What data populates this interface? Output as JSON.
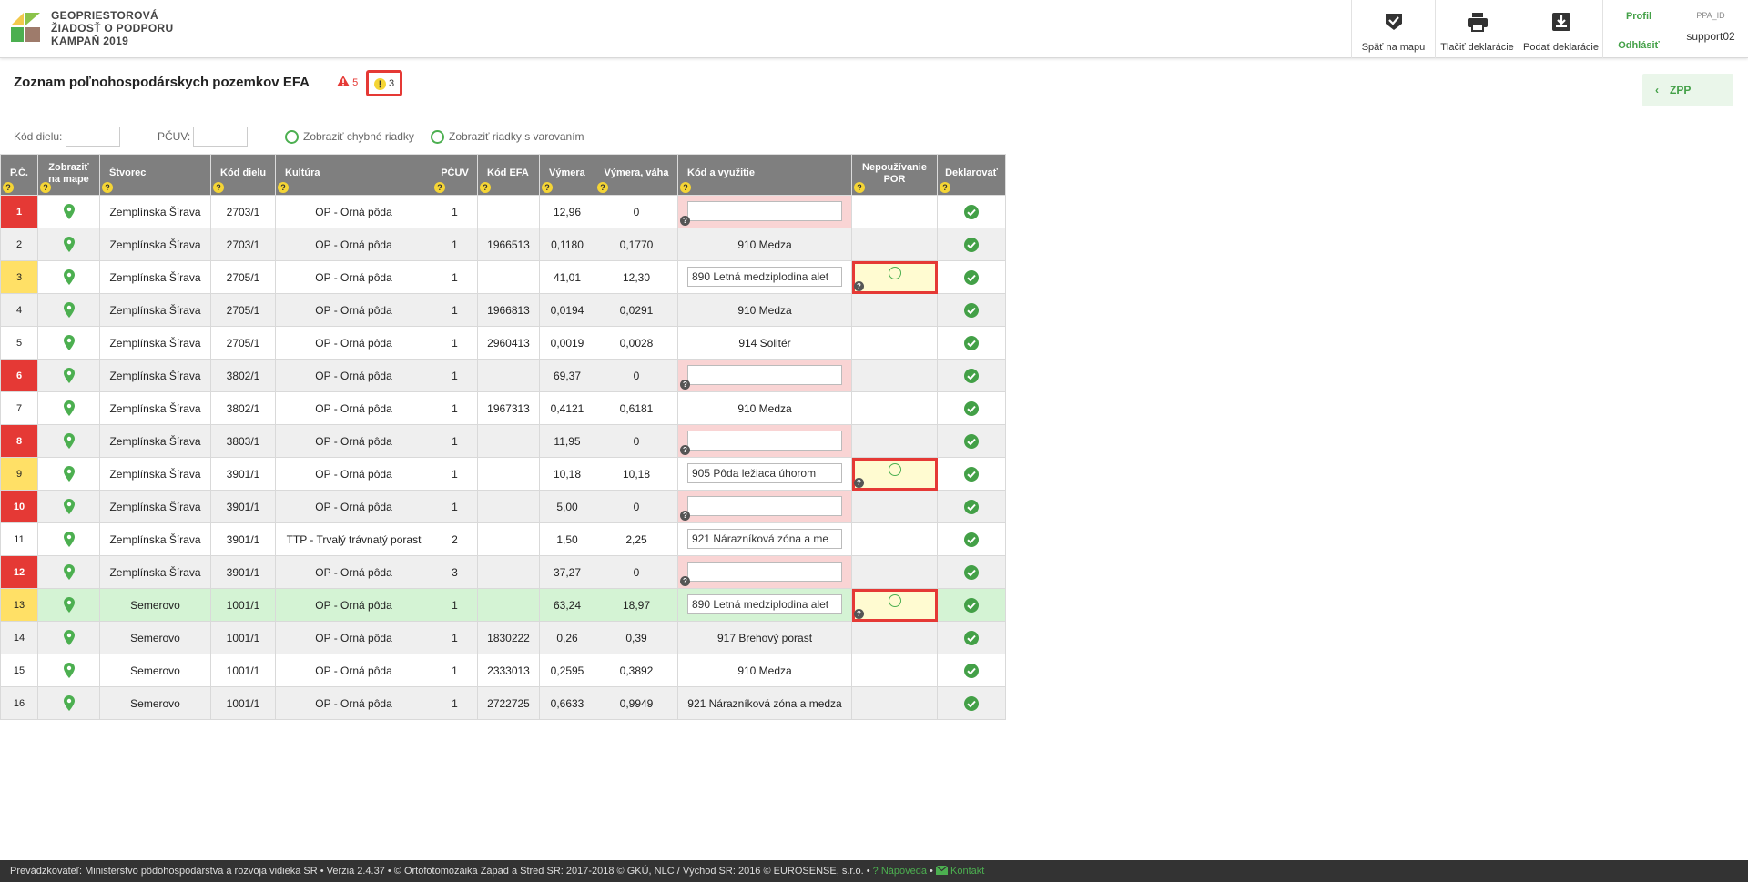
{
  "header": {
    "title_line1": "GEOPRIESTOROVÁ",
    "title_line2": "ŽIADOSŤ O PODPORU",
    "title_line3": "KAMPAŇ 2019",
    "buttons": [
      {
        "label": "Späť na mapu"
      },
      {
        "label": "Tlačiť deklarácie"
      },
      {
        "label": "Podať deklarácie"
      }
    ],
    "profile": "Profil",
    "logout": "Odhlásiť",
    "user_id_label": "PPA_ID",
    "username": "support02"
  },
  "page": {
    "title": "Zoznam poľnohospodárskych pozemkov EFA",
    "error_count": "5",
    "warning_count": "3",
    "zpp_label": "ZPP"
  },
  "filters": {
    "kod_dielu_label": "Kód dielu:",
    "pcuv_label": "PČUV:",
    "show_errors_label": "Zobraziť chybné riadky",
    "show_warnings_label": "Zobraziť riadky s varovaním"
  },
  "table": {
    "headers": {
      "pc": "P.Č.",
      "map_line1": "Zobraziť",
      "map_line2": "na mape",
      "stvorec": "Štvorec",
      "kod_dielu": "Kód dielu",
      "kultura": "Kultúra",
      "pcuv": "PČUV",
      "kod_efa": "Kód EFA",
      "vymera": "Výmera",
      "vymera_vaha": "Výmera, váha",
      "kod_vyuzitie": "Kód a využitie",
      "nepouzivanie_line1": "Nepoužívanie",
      "nepouzivanie_line2": "POR",
      "deklarovat": "Deklarovať"
    },
    "rows": [
      {
        "pc": "1",
        "stvorec": "Zemplínska Šírava",
        "kod_dielu": "2703/1",
        "kultura": "OP - Orná pôda",
        "pcuv": "1",
        "kod_efa": "",
        "vymera": "12,96",
        "vaha": "0",
        "kod": ""
      },
      {
        "pc": "2",
        "stvorec": "Zemplínska Šírava",
        "kod_dielu": "2703/1",
        "kultura": "OP - Orná pôda",
        "pcuv": "1",
        "kod_efa": "1966513",
        "vymera": "0,1180",
        "vaha": "0,1770",
        "kod": "910 Medza"
      },
      {
        "pc": "3",
        "stvorec": "Zemplínska Šírava",
        "kod_dielu": "2705/1",
        "kultura": "OP - Orná pôda",
        "pcuv": "1",
        "kod_efa": "",
        "vymera": "41,01",
        "vaha": "12,30",
        "kod": "890  Letná medziplodina alet"
      },
      {
        "pc": "4",
        "stvorec": "Zemplínska Šírava",
        "kod_dielu": "2705/1",
        "kultura": "OP - Orná pôda",
        "pcuv": "1",
        "kod_efa": "1966813",
        "vymera": "0,0194",
        "vaha": "0,0291",
        "kod": "910 Medza"
      },
      {
        "pc": "5",
        "stvorec": "Zemplínska Šírava",
        "kod_dielu": "2705/1",
        "kultura": "OP - Orná pôda",
        "pcuv": "1",
        "kod_efa": "2960413",
        "vymera": "0,0019",
        "vaha": "0,0028",
        "kod": "914 Solitér"
      },
      {
        "pc": "6",
        "stvorec": "Zemplínska Šírava",
        "kod_dielu": "3802/1",
        "kultura": "OP - Orná pôda",
        "pcuv": "1",
        "kod_efa": "",
        "vymera": "69,37",
        "vaha": "0",
        "kod": ""
      },
      {
        "pc": "7",
        "stvorec": "Zemplínska Šírava",
        "kod_dielu": "3802/1",
        "kultura": "OP - Orná pôda",
        "pcuv": "1",
        "kod_efa": "1967313",
        "vymera": "0,4121",
        "vaha": "0,6181",
        "kod": "910 Medza"
      },
      {
        "pc": "8",
        "stvorec": "Zemplínska Šírava",
        "kod_dielu": "3803/1",
        "kultura": "OP - Orná pôda",
        "pcuv": "1",
        "kod_efa": "",
        "vymera": "11,95",
        "vaha": "0",
        "kod": ""
      },
      {
        "pc": "9",
        "stvorec": "Zemplínska Šírava",
        "kod_dielu": "3901/1",
        "kultura": "OP - Orná pôda",
        "pcuv": "1",
        "kod_efa": "",
        "vymera": "10,18",
        "vaha": "10,18",
        "kod": "905  Pôda ležiaca úhorom"
      },
      {
        "pc": "10",
        "stvorec": "Zemplínska Šírava",
        "kod_dielu": "3901/1",
        "kultura": "OP - Orná pôda",
        "pcuv": "1",
        "kod_efa": "",
        "vymera": "5,00",
        "vaha": "0",
        "kod": ""
      },
      {
        "pc": "11",
        "stvorec": "Zemplínska Šírava",
        "kod_dielu": "3901/1",
        "kultura": "TTP - Trvalý trávnatý porast",
        "pcuv": "2",
        "kod_efa": "",
        "vymera": "1,50",
        "vaha": "2,25",
        "kod": "921  Nárazníková zóna a me"
      },
      {
        "pc": "12",
        "stvorec": "Zemplínska Šírava",
        "kod_dielu": "3901/1",
        "kultura": "OP - Orná pôda",
        "pcuv": "3",
        "kod_efa": "",
        "vymera": "37,27",
        "vaha": "0",
        "kod": ""
      },
      {
        "pc": "13",
        "stvorec": "Semerovo",
        "kod_dielu": "1001/1",
        "kultura": "OP - Orná pôda",
        "pcuv": "1",
        "kod_efa": "",
        "vymera": "63,24",
        "vaha": "18,97",
        "kod": "890  Letná medziplodina alet"
      },
      {
        "pc": "14",
        "stvorec": "Semerovo",
        "kod_dielu": "1001/1",
        "kultura": "OP - Orná pôda",
        "pcuv": "1",
        "kod_efa": "1830222",
        "vymera": "0,26",
        "vaha": "0,39",
        "kod": "917 Brehový porast"
      },
      {
        "pc": "15",
        "stvorec": "Semerovo",
        "kod_dielu": "1001/1",
        "kultura": "OP - Orná pôda",
        "pcuv": "1",
        "kod_efa": "2333013",
        "vymera": "0,2595",
        "vaha": "0,3892",
        "kod": "910 Medza"
      },
      {
        "pc": "16",
        "stvorec": "Semerovo",
        "kod_dielu": "1001/1",
        "kultura": "OP - Orná pôda",
        "pcuv": "1",
        "kod_efa": "2722725",
        "vymera": "0,6633",
        "vaha": "0,9949",
        "kod": "921 Nárazníková zóna a medza"
      }
    ]
  },
  "footer": {
    "text": "Prevádzkovateľ: Ministerstvo pôdohospodárstva a rozvoja vidieka SR • Verzia 2.4.37 • © Ortofotomozaika Západ a Stred SR: 2017-2018 © GKÚ, NLC / Východ SR: 2016 © EUROSENSE, s.r.o. •",
    "help": "Nápoveda",
    "contact": "Kontakt"
  },
  "colors": {
    "accent_green": "#43a047",
    "error_red": "#e53935",
    "warning_yellow": "#ffe066",
    "header_gray": "#7f7f7f"
  }
}
